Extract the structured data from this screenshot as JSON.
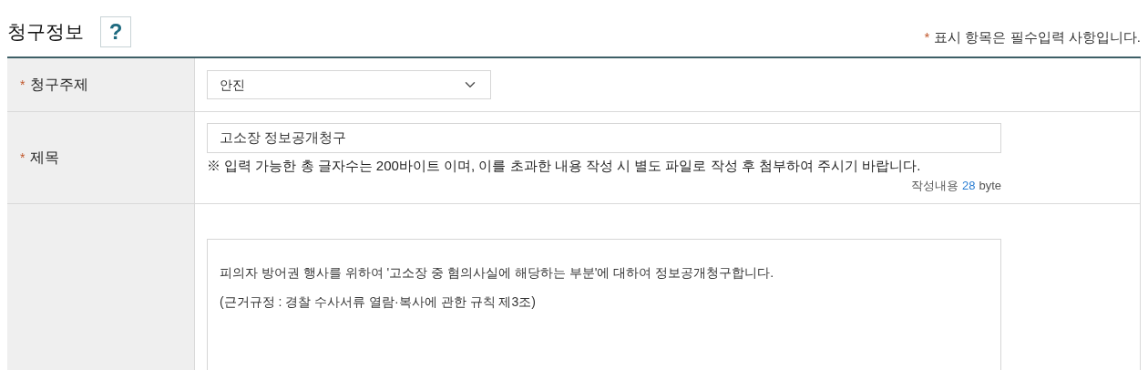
{
  "section": {
    "title": "청구정보",
    "help_icon": "?",
    "legend_mark": "*",
    "legend": "표시 항목은 필수입력 사항입니다."
  },
  "rows": [
    {
      "kind": "select",
      "mark": "*",
      "label": "청구주제",
      "value": "안진"
    },
    {
      "kind": "text",
      "mark": "*",
      "label": "제목",
      "value": "고소장 정보공개청구",
      "note": "※ 입력 가능한 총 글자수는 200바이트 이며, 이를 초과한 내용 작성 시 별도 파일로 작성 후 첨부하여 주시기 바랍니다.",
      "counter_label": "작성내용",
      "counter_value": "28",
      "counter_unit": "byte"
    },
    {
      "kind": "textarea",
      "lines": [
        "피의자 방어권 행사를 위하여 '고소장 중 혐의사실에 해당하는 부분'에 대하여 정보공개청구합니다.",
        "(근거규정 : 경찰 수사서류 열람·복사에 관한 규칙 제3조)"
      ]
    }
  ]
}
